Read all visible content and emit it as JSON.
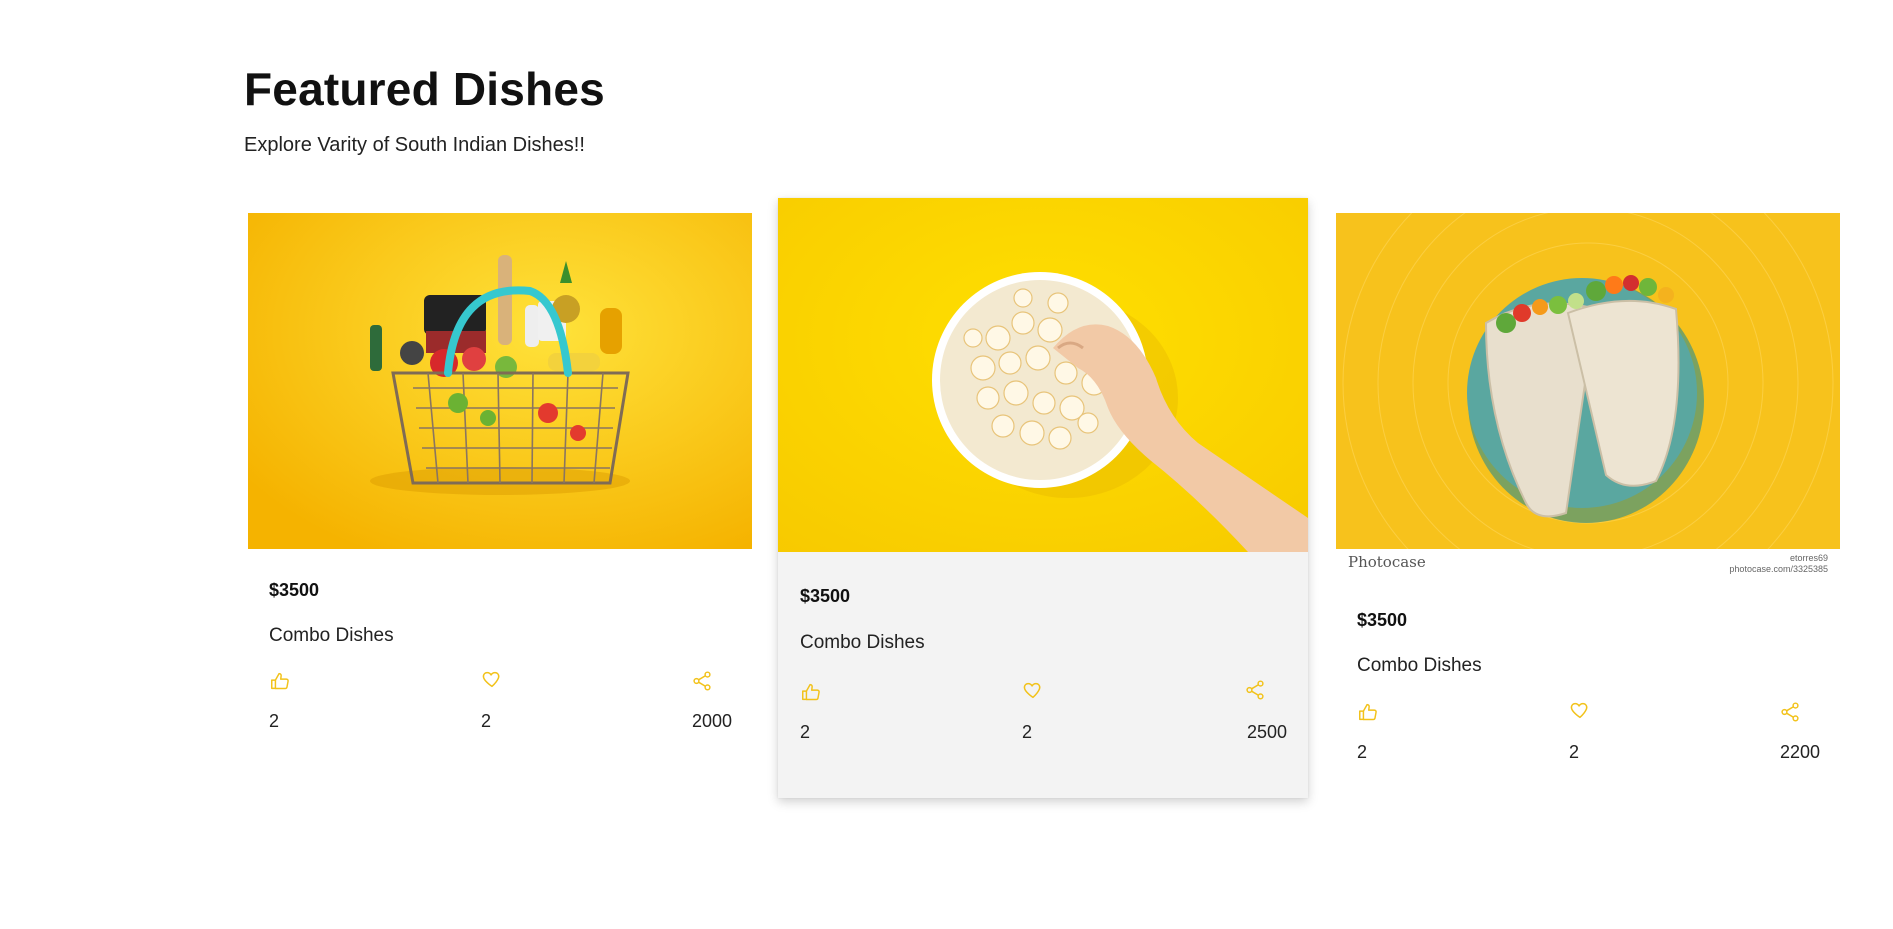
{
  "section": {
    "title": "Featured Dishes",
    "subtitle": "Explore Varity of South Indian Dishes!!"
  },
  "accent_color": "#f2c21a",
  "cards": [
    {
      "image": "grocery-basket-image",
      "price": "$3500",
      "name": "Combo Dishes",
      "likes": "2",
      "favorites": "2",
      "shares": "2000",
      "icons": [
        "thumbs-up-icon",
        "heart-icon",
        "share-icon"
      ]
    },
    {
      "image": "popcorn-bowl-image",
      "price": "$3500",
      "name": "Combo Dishes",
      "likes": "2",
      "favorites": "2",
      "shares": "2500",
      "icons": [
        "thumbs-up-icon",
        "heart-icon",
        "share-icon"
      ]
    },
    {
      "image": "wrap-plate-image",
      "price": "$3500",
      "name": "Combo Dishes",
      "likes": "2",
      "favorites": "2",
      "shares": "2200",
      "icons": [
        "thumbs-up-icon",
        "heart-icon",
        "share-icon"
      ],
      "watermark_left": "Photocase",
      "watermark_right_user": "etorres69",
      "watermark_right_url": "photocase.com/3325385"
    }
  ]
}
